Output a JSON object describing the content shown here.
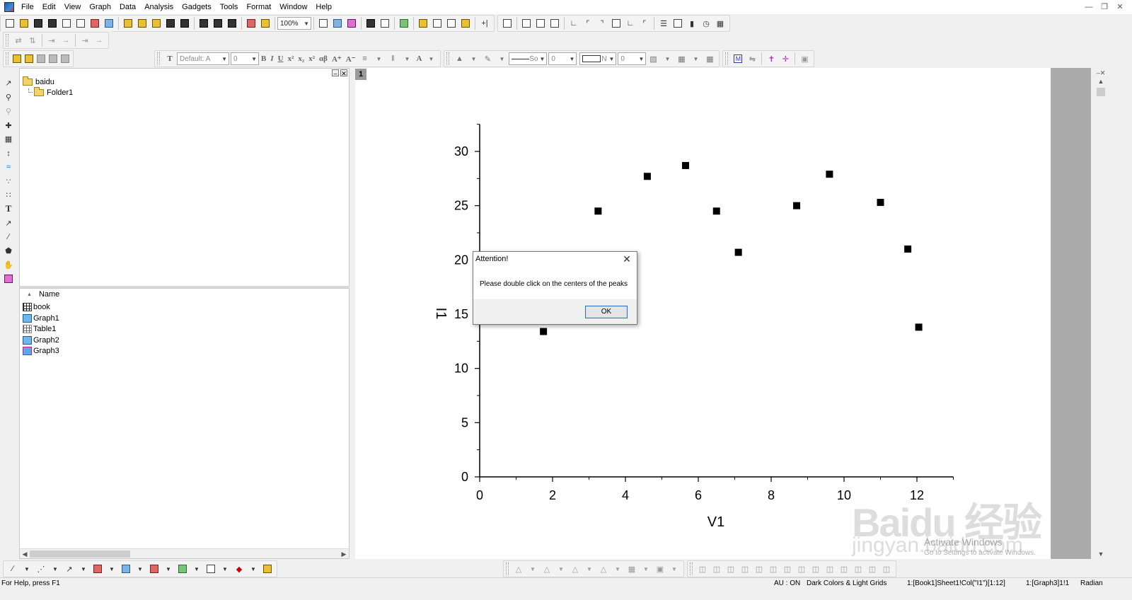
{
  "menu": [
    "File",
    "Edit",
    "View",
    "Graph",
    "Data",
    "Analysis",
    "Gadgets",
    "Tools",
    "Format",
    "Window",
    "Help"
  ],
  "toolbar": {
    "zoom": "100%",
    "font_name": "Default: A",
    "font_size": "0",
    "line_style": "So",
    "line_width": "0",
    "border_style": "N",
    "border_width": "0"
  },
  "project_explorer": {
    "root": "baidu",
    "folder": "Folder1",
    "list_header": "Name",
    "items": [
      {
        "name": "book",
        "icon": "workbook-icon"
      },
      {
        "name": "Graph1",
        "icon": "graph-icon"
      },
      {
        "name": "Table1",
        "icon": "table-icon"
      },
      {
        "name": "Graph2",
        "icon": "graph-icon"
      },
      {
        "name": "Graph3",
        "icon": "graph-icon"
      }
    ]
  },
  "graph": {
    "layer_label": "1"
  },
  "chart_data": {
    "type": "scatter",
    "xlabel": "V1",
    "ylabel": "I1",
    "xlim": [
      0,
      13
    ],
    "ylim": [
      0,
      32.5
    ],
    "x_ticks": [
      0,
      2,
      4,
      6,
      8,
      10,
      12
    ],
    "y_ticks": [
      0,
      5,
      10,
      15,
      20,
      25,
      30
    ],
    "series": [
      {
        "x": [
          1.75,
          3.25,
          4.6,
          5.65,
          6.5,
          7.1,
          8.7,
          9.6,
          11.0,
          11.75,
          12.05
        ],
        "y": [
          13.4,
          24.5,
          27.7,
          28.7,
          24.5,
          20.7,
          25.0,
          27.9,
          25.3,
          21.0,
          13.8
        ]
      }
    ]
  },
  "dialog": {
    "title": "Attention!",
    "message": "Please double click on the centers of the peaks",
    "ok_label": "OK"
  },
  "status": {
    "help": "For Help, press F1",
    "au": "AU : ON",
    "theme": "Dark Colors & Light Grids",
    "cell": "1:[Book1]Sheet1!Col(\"I1\")[1:12]",
    "layer": "1:[Graph3]1!1",
    "angle": "Radian"
  },
  "watermark": {
    "brand": "Baidu 经验",
    "site": "jingyan.baidu.com",
    "activate_title": "Activate Windows",
    "activate_sub": "Go to Settings to activate Windows."
  },
  "colors": {
    "marker": "#000000",
    "mdi_background": "#ababab",
    "ok_border": "#2d6fc4"
  }
}
